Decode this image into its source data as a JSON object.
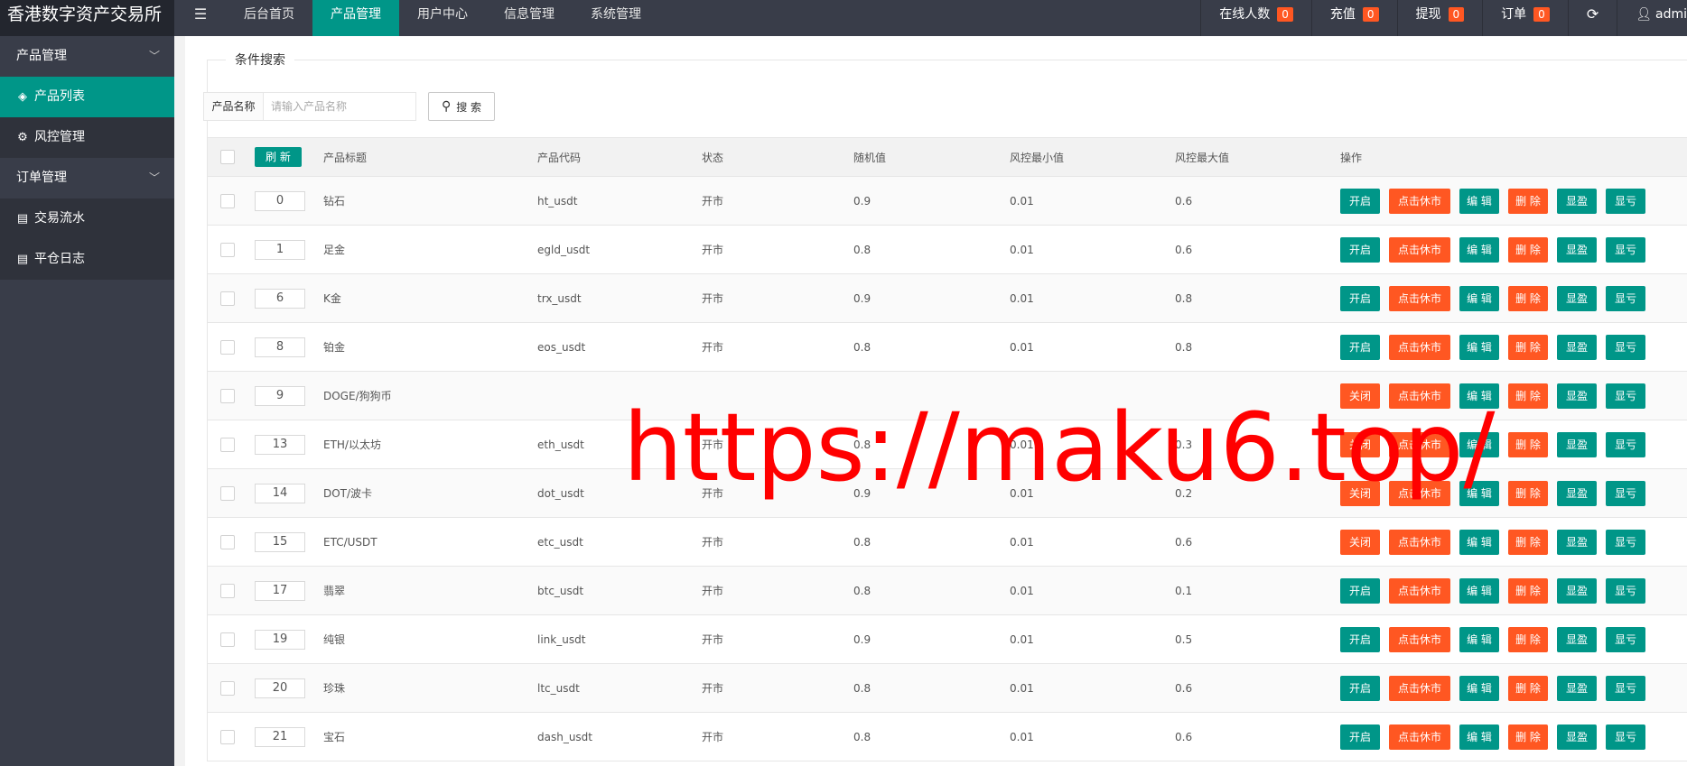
{
  "header": {
    "logo": "香港数字资产交易所",
    "menu_icon": "hamburger-icon",
    "nav": [
      {
        "label": "后台首页"
      },
      {
        "label": "产品管理"
      },
      {
        "label": "用户中心"
      },
      {
        "label": "信息管理"
      },
      {
        "label": "系统管理"
      }
    ],
    "right": [
      {
        "label": "在线人数",
        "count": "0"
      },
      {
        "label": "充值",
        "count": "0"
      },
      {
        "label": "提现",
        "count": "0"
      },
      {
        "label": "订单",
        "count": "0"
      }
    ],
    "refresh_icon": "refresh-icon",
    "user": "admi",
    "user_icon": "user-icon"
  },
  "sidebar": {
    "groups": [
      {
        "label": "产品管理",
        "items": [
          {
            "label": "产品列表",
            "icon": "layers-icon"
          },
          {
            "label": "风控管理",
            "icon": "gear-icon"
          }
        ]
      },
      {
        "label": "订单管理",
        "items": [
          {
            "label": "交易流水",
            "icon": "document-icon"
          },
          {
            "label": "平仓日志",
            "icon": "document-icon"
          }
        ]
      }
    ]
  },
  "search": {
    "legend": "条件搜索",
    "label": "产品名称",
    "placeholder": "请输入产品名称",
    "button": "搜 索"
  },
  "table": {
    "refresh": "刷 新",
    "columns": [
      "产品标题",
      "产品代码",
      "状态",
      "随机值",
      "风控最小值",
      "风控最大值",
      "操作"
    ],
    "buttons": {
      "start": "开启",
      "close": "关闭",
      "holiday": "点击休市",
      "edit": "编 辑",
      "delete": "删 除",
      "profit": "显盈",
      "loss": "显亏"
    },
    "rows": [
      {
        "sort": "0",
        "title": "钻石",
        "code": "ht_usdt",
        "status": "开市",
        "random": "0.9",
        "min": "0.01",
        "max": "0.6",
        "toggle": "开启"
      },
      {
        "sort": "1",
        "title": "足金",
        "code": "egld_usdt",
        "status": "开市",
        "random": "0.8",
        "min": "0.01",
        "max": "0.6",
        "toggle": "开启"
      },
      {
        "sort": "6",
        "title": "K金",
        "code": "trx_usdt",
        "status": "开市",
        "random": "0.9",
        "min": "0.01",
        "max": "0.8",
        "toggle": "开启"
      },
      {
        "sort": "8",
        "title": "铂金",
        "code": "eos_usdt",
        "status": "开市",
        "random": "0.8",
        "min": "0.01",
        "max": "0.8",
        "toggle": "开启"
      },
      {
        "sort": "9",
        "title": "DOGE/狗狗币",
        "code": "",
        "status": "",
        "random": "",
        "min": "",
        "max": "",
        "toggle": "关闭"
      },
      {
        "sort": "13",
        "title": "ETH/以太坊",
        "code": "eth_usdt",
        "status": "开市",
        "random": "0.8",
        "min": "0.01",
        "max": "0.3",
        "toggle": "关闭"
      },
      {
        "sort": "14",
        "title": "DOT/波卡",
        "code": "dot_usdt",
        "status": "开市",
        "random": "0.9",
        "min": "0.01",
        "max": "0.2",
        "toggle": "关闭"
      },
      {
        "sort": "15",
        "title": "ETC/USDT",
        "code": "etc_usdt",
        "status": "开市",
        "random": "0.8",
        "min": "0.01",
        "max": "0.6",
        "toggle": "关闭"
      },
      {
        "sort": "17",
        "title": "翡翠",
        "code": "btc_usdt",
        "status": "开市",
        "random": "0.8",
        "min": "0.01",
        "max": "0.1",
        "toggle": "开启"
      },
      {
        "sort": "19",
        "title": "纯银",
        "code": "link_usdt",
        "status": "开市",
        "random": "0.9",
        "min": "0.01",
        "max": "0.5",
        "toggle": "开启"
      },
      {
        "sort": "20",
        "title": "珍珠",
        "code": "ltc_usdt",
        "status": "开市",
        "random": "0.8",
        "min": "0.01",
        "max": "0.6",
        "toggle": "开启"
      },
      {
        "sort": "21",
        "title": "宝石",
        "code": "dash_usdt",
        "status": "开市",
        "random": "0.8",
        "min": "0.01",
        "max": "0.6",
        "toggle": "开启"
      }
    ]
  },
  "watermark": "https://maku6.top/",
  "colors": {
    "accent": "#009688",
    "danger": "#ff5722",
    "topbar": "#393d49",
    "watermark": "#ff0000"
  }
}
